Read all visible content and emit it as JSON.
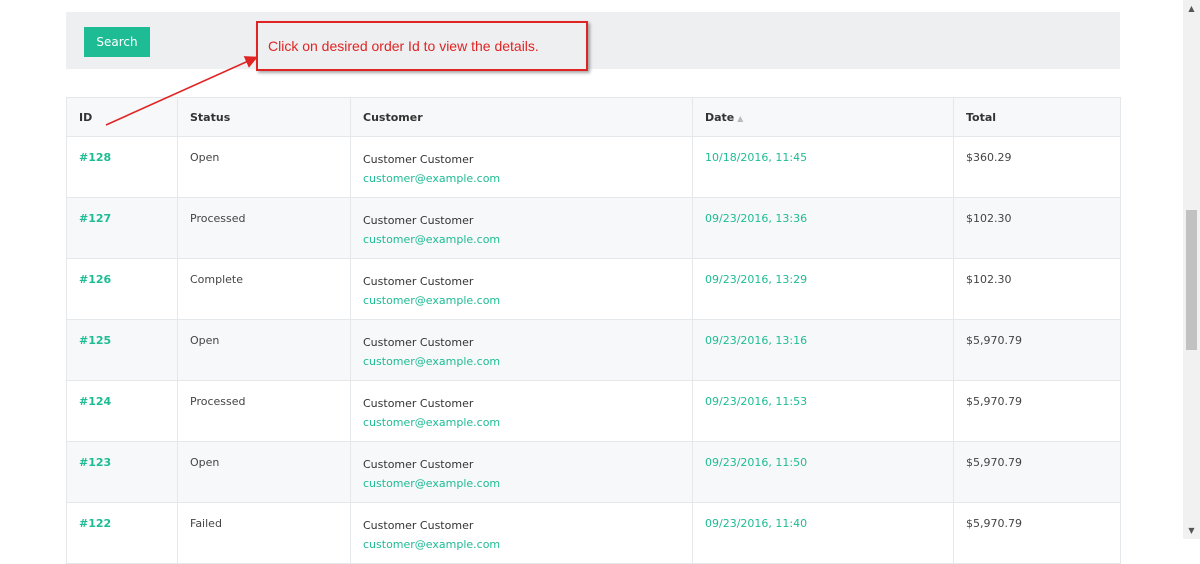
{
  "search": {
    "button_label": "Search"
  },
  "callout": {
    "text": "Click on desired order Id to view the details."
  },
  "table": {
    "headers": {
      "id": "ID",
      "status": "Status",
      "customer": "Customer",
      "date": "Date",
      "total": "Total"
    },
    "rows": [
      {
        "id": "#128",
        "status": "Open",
        "customer_name": "Customer Customer",
        "customer_email": "customer@example.com",
        "date": "10/18/2016, 11:45",
        "total": "$360.29"
      },
      {
        "id": "#127",
        "status": "Processed",
        "customer_name": "Customer Customer",
        "customer_email": "customer@example.com",
        "date": "09/23/2016, 13:36",
        "total": "$102.30"
      },
      {
        "id": "#126",
        "status": "Complete",
        "customer_name": "Customer Customer",
        "customer_email": "customer@example.com",
        "date": "09/23/2016, 13:29",
        "total": "$102.30"
      },
      {
        "id": "#125",
        "status": "Open",
        "customer_name": "Customer Customer",
        "customer_email": "customer@example.com",
        "date": "09/23/2016, 13:16",
        "total": "$5,970.79"
      },
      {
        "id": "#124",
        "status": "Processed",
        "customer_name": "Customer Customer",
        "customer_email": "customer@example.com",
        "date": "09/23/2016, 11:53",
        "total": "$5,970.79"
      },
      {
        "id": "#123",
        "status": "Open",
        "customer_name": "Customer Customer",
        "customer_email": "customer@example.com",
        "date": "09/23/2016, 11:50",
        "total": "$5,970.79"
      },
      {
        "id": "#122",
        "status": "Failed",
        "customer_name": "Customer Customer",
        "customer_email": "customer@example.com",
        "date": "09/23/2016, 11:40",
        "total": "$5,970.79"
      }
    ]
  },
  "colors": {
    "accent": "#1ebc94",
    "annotation": "#e02424"
  },
  "icons": {
    "sort": "sort-asc-icon",
    "scroll_up": "scroll-up-icon",
    "scroll_down": "scroll-down-icon"
  }
}
